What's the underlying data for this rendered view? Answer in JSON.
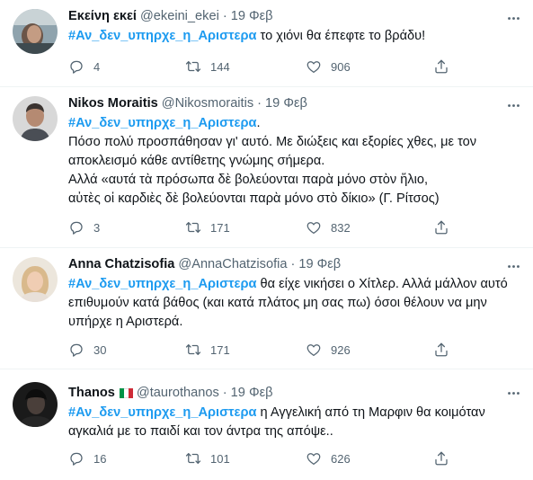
{
  "tweets": [
    {
      "name": "Εκείνη εκεί",
      "handle": "@ekeini_ekei",
      "separator": "·",
      "date": "19 Φεβ",
      "hashtag": "#Αν_δεν_υπηρχε_η_Αριστερα",
      "text": " το χιόνι θα έπεφτε το βράδυ!",
      "replies": "4",
      "retweets": "144",
      "likes": "906"
    },
    {
      "name": "Nikos Moraitis",
      "handle": "@Nikosmoraitis",
      "separator": "·",
      "date": "19 Φεβ",
      "hashtag": "#Αν_δεν_υπηρχε_η_Αριστερα",
      "text": ".\nΠόσο πολύ προσπάθησαν γι' αυτό. Με διώξεις και εξορίες χθες, με τον αποκλεισμό κάθε αντίθετης γνώμης σήμερα.\nΑλλά «αυτά τὰ πρόσωπα δὲ βολεύονται παρὰ μόνο στὸν ἥλιο,\nαὐτὲς οἱ καρδιὲς δὲ βολεύονται παρὰ μόνο στὸ δίκιο» (Γ. Ρίτσος)",
      "replies": "3",
      "retweets": "171",
      "likes": "832"
    },
    {
      "name": "Anna Chatzisofia",
      "handle": "@AnnaChatzisofia",
      "separator": "·",
      "date": "19 Φεβ",
      "hashtag": "#Αν_δεν_υπηρχε_η_Αριστερα",
      "text": " θα είχε νικήσει ο Χίτλερ. Αλλά μάλλον αυτό επιθυμούν κατά βάθος (και κατά πλάτος μη σας πω) όσοι θέλουν να μην υπήρχε η Αριστερά.",
      "replies": "30",
      "retweets": "171",
      "likes": "926"
    },
    {
      "name": "Thanos",
      "handle": "@taurothanos",
      "separator": "·",
      "date": "19 Φεβ",
      "hashtag": "#Αν_δεν_υπηρχε_η_Αριστερα",
      "text": " η Αγγελική από τη Μαρφιν θα κοιμόταν αγκαλιά με το παιδί και τον άντρα της απόψε..",
      "replies": "16",
      "retweets": "101",
      "likes": "626"
    }
  ],
  "colors": {
    "accent": "#1d9bf0",
    "secondary_text": "#536471",
    "divider": "#eff3f4"
  },
  "icons": {
    "reply": "reply-icon",
    "retweet": "retweet-icon",
    "like": "heart-icon",
    "share": "share-icon",
    "more": "more-icon",
    "flag": "italy-flag-icon"
  }
}
